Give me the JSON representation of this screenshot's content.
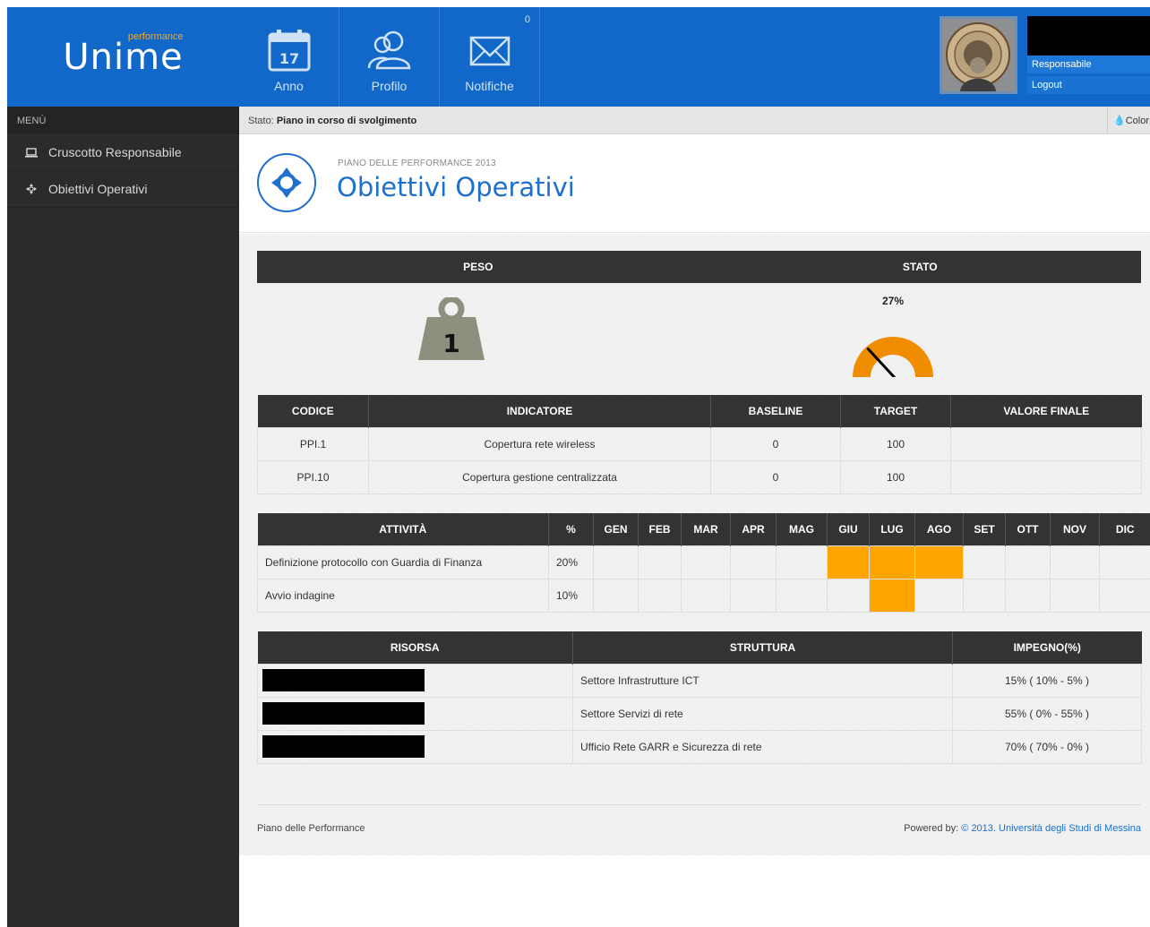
{
  "brand": {
    "logo_text": "Unime",
    "logo_tag": "performance"
  },
  "topnav": {
    "anno": {
      "label": "Anno",
      "day": "17"
    },
    "profilo": {
      "label": "Profilo"
    },
    "notifiche": {
      "label": "Notifiche",
      "count": "0"
    }
  },
  "user": {
    "role": "Responsabile",
    "logout": "Logout"
  },
  "sidebar": {
    "title": "MENÙ",
    "items": [
      {
        "label": "Cruscotto Responsabile",
        "icon": "laptop-icon"
      },
      {
        "label": "Obiettivi Operativi",
        "icon": "crosshair-icon"
      }
    ]
  },
  "status": {
    "prefix": "Stato:",
    "value": "Piano in corso di svolgimento",
    "color_button": "Color"
  },
  "page": {
    "subtitle": "PIANO DELLE PERFORMANCE 2013",
    "title": "Obiettivi Operativi"
  },
  "summary": {
    "peso_header": "PESO",
    "stato_header": "STATO",
    "peso_value": "1",
    "stato_percent_label": "27%",
    "stato_percent": 27
  },
  "indicators": {
    "headers": [
      "CODICE",
      "INDICATORE",
      "BASELINE",
      "TARGET",
      "VALORE FINALE"
    ],
    "rows": [
      {
        "codice": "PPI.1",
        "indicatore": "Copertura rete wireless",
        "baseline": "0",
        "target": "100",
        "valore": ""
      },
      {
        "codice": "PPI.10",
        "indicatore": "Copertura gestione centralizzata",
        "baseline": "0",
        "target": "100",
        "valore": ""
      }
    ]
  },
  "activities": {
    "headers": [
      "ATTIVITÀ",
      "%",
      "GEN",
      "FEB",
      "MAR",
      "APR",
      "MAG",
      "GIU",
      "LUG",
      "AGO",
      "SET",
      "OTT",
      "NOV",
      "DIC"
    ],
    "rows": [
      {
        "name": "Definizione protocollo con Guardia di Finanza",
        "pct": "20%",
        "active_months": [
          "GIU",
          "LUG",
          "AGO"
        ]
      },
      {
        "name": "Avvio indagine",
        "pct": "10%",
        "active_months": [
          "LUG"
        ]
      }
    ],
    "highlight_color": "#ffa500"
  },
  "resources": {
    "headers": [
      "RISORSA",
      "STRUTTURA",
      "IMPEGNO(%)"
    ],
    "rows": [
      {
        "struttura": "Settore Infrastrutture ICT",
        "impegno": "15% ( 10% - 5% )"
      },
      {
        "struttura": "Settore Servizi di rete",
        "impegno": "55% ( 0% - 55% )"
      },
      {
        "struttura": "Ufficio Rete GARR e Sicurezza di rete",
        "impegno": "70% ( 70% - 0% )"
      }
    ]
  },
  "footer": {
    "left": "Piano delle Performance",
    "powered": "Powered by:",
    "link": "© 2013. Università degli Studi di Messina"
  },
  "colors": {
    "primary": "#1168c8",
    "accent": "#ffa500",
    "sidebar": "#2b2b2b",
    "table_header": "#333333"
  }
}
